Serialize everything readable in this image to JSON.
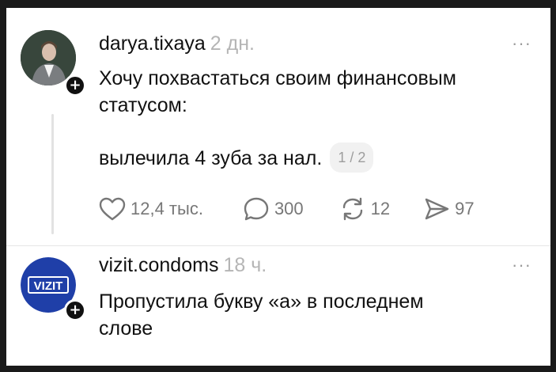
{
  "post1": {
    "username": "darya.tixaya",
    "time": "2 дн.",
    "line1": "Хочу похвастаться своим финансовым",
    "line2": "статусом:",
    "caption": "вылечила 4 зуба за нал.",
    "pager": "1 / 2",
    "likes": "12,4 тыс.",
    "comments": "300",
    "reposts": "12",
    "shares": "97",
    "more_label": "···",
    "follow_label": "+"
  },
  "post2": {
    "username": "vizit.condoms",
    "time": "18 ч.",
    "line1": "Пропустила букву «а» в последнем",
    "line2": "слове",
    "avatar_logo": "VIZIT",
    "more_label": "···",
    "follow_label": "+"
  },
  "icons": [
    "heart-icon",
    "comment-icon",
    "repost-icon",
    "share-icon",
    "more-icon",
    "follow-plus-icon"
  ],
  "colors": {
    "text": "#111111",
    "muted": "#b5b5b5",
    "action": "#777777",
    "logo_bg": "#1f3fa8"
  }
}
